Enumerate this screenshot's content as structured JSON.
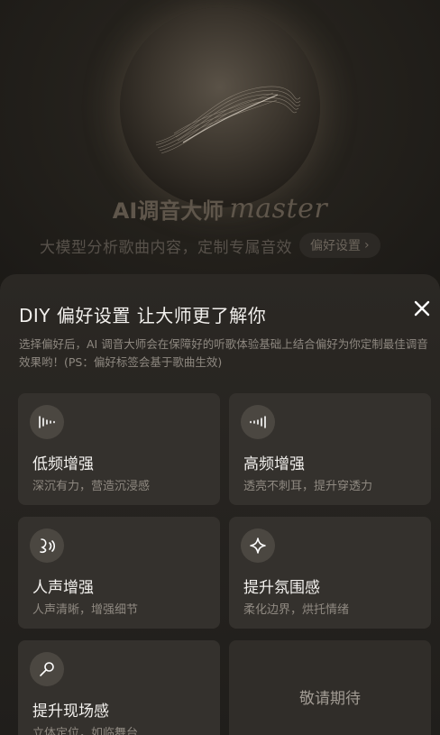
{
  "hero": {
    "title_cn": "AI调音大师",
    "title_en": "master",
    "subtitle": "大模型分析歌曲内容，定制专属音效",
    "pref_button_label": "偏好设置",
    "pref_button_chevron": "›"
  },
  "sheet": {
    "title": "DIY 偏好设置 让大师更了解你",
    "description": "选择偏好后，AI 调音大师会在保障好的听歌体验基础上结合偏好为你定制最佳调音效果哟！(PS：偏好标签会基于歌曲生效)",
    "close_icon": "close-icon"
  },
  "options": [
    {
      "icon": "bass-wave-icon",
      "name": "低频增强",
      "desc": "深沉有力，营造沉浸感"
    },
    {
      "icon": "treble-wave-icon",
      "name": "高频增强",
      "desc": "透亮不刺耳，提升穿透力"
    },
    {
      "icon": "voice-icon",
      "name": "人声增强",
      "desc": "人声清晰，增强细节"
    },
    {
      "icon": "sparkle-icon",
      "name": "提升氛围感",
      "desc": "柔化边界，烘托情绪"
    },
    {
      "icon": "microphone-icon",
      "name": "提升现场感",
      "desc": "立体定位，如临舞台"
    }
  ],
  "coming_soon_label": "敬请期待",
  "colors": {
    "accent": "#f3f1ee",
    "card_bg": "#34312d",
    "icon_bg": "#4b4741"
  }
}
